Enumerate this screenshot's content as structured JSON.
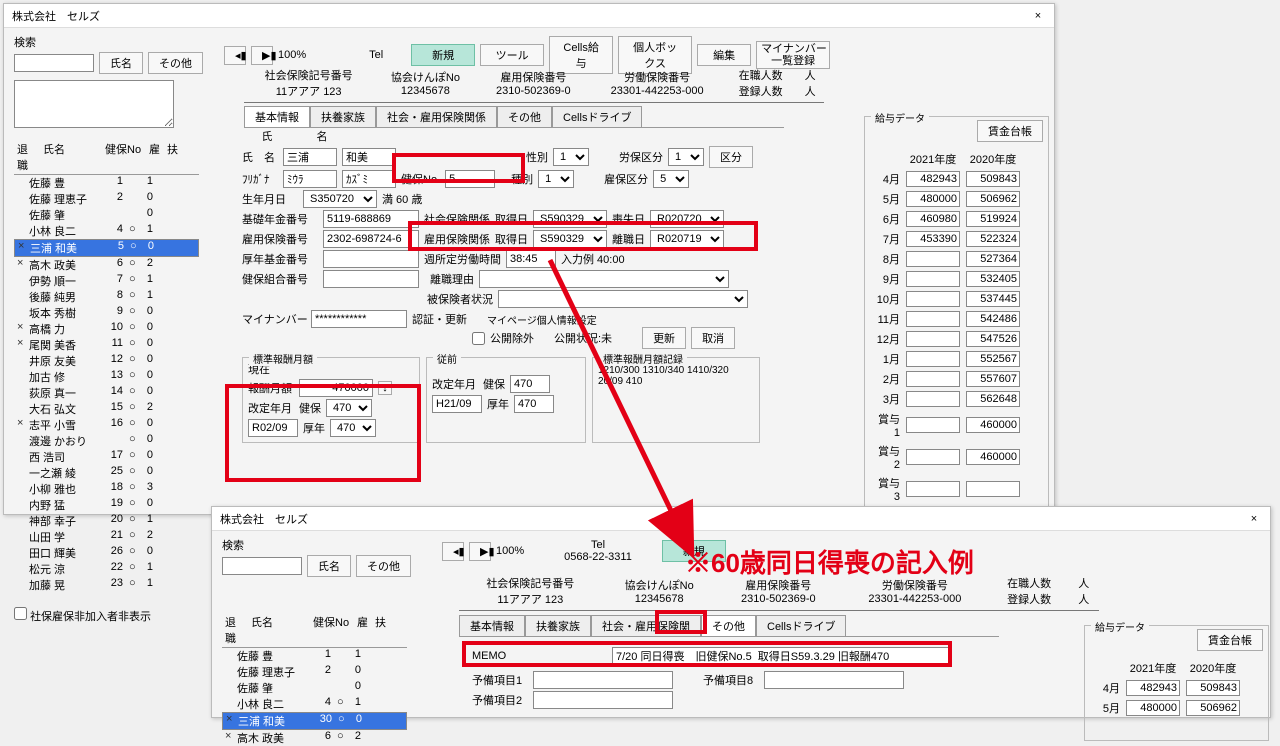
{
  "app_title": "株式会社　セルズ",
  "search": {
    "label": "検索",
    "btn_name": "氏名",
    "btn_other": "その他"
  },
  "chk_hiexclude": "社保雇保非加入者非表示",
  "nav": {
    "zoom": "100%",
    "tel": "Tel",
    "new": "新規",
    "tool": "ツール",
    "cellspay": "Cells給与",
    "personal": "個人ボックス",
    "edit": "編集",
    "mynumber": "マイナンバー\n一覧登録"
  },
  "nav2": {
    "tel": "Tel",
    "tel_val": "0568-22-3311"
  },
  "hdr": {
    "c1": {
      "label": "社会保険記号番号",
      "val": "11アアア 123"
    },
    "c2": {
      "label": "協会けんぽNo",
      "val": "12345678"
    },
    "c3": {
      "label": "雇用保険番号",
      "val": "2310-502369-0"
    },
    "c4": {
      "label": "労働保険番号",
      "val": "23301-442253-000"
    },
    "c5": {
      "label1": "在職人数",
      "label2": "登録人数",
      "unit": "人"
    }
  },
  "tabs": {
    "basic": "基本情報",
    "dependents": "扶養家族",
    "social": "社会・雇用保険関係",
    "other": "その他",
    "drive": "Cellsドライブ",
    "social2": "社会・雇用保険関"
  },
  "list": {
    "hdr": {
      "ret": "退職",
      "name": "氏名",
      "kenpo": "健保No",
      "emp": "雇",
      "dep": "扶"
    },
    "rows": [
      {
        "x": "",
        "n": "佐藤 豊",
        "k": "1",
        "e": "",
        "d": "1"
      },
      {
        "x": "",
        "n": "佐藤 理恵子",
        "k": "2",
        "e": "",
        "d": "0"
      },
      {
        "x": "",
        "n": "佐藤 肇",
        "k": "",
        "e": "",
        "d": "0"
      },
      {
        "x": "",
        "n": "小林 良二",
        "k": "4",
        "e": "○",
        "d": "1"
      },
      {
        "x": "×",
        "n": "三浦 和美",
        "k": "5",
        "e": "○",
        "d": "0",
        "sel": true
      },
      {
        "x": "×",
        "n": "高木 政美",
        "k": "6",
        "e": "○",
        "d": "2"
      },
      {
        "x": "",
        "n": "伊勢 順一",
        "k": "7",
        "e": "○",
        "d": "1"
      },
      {
        "x": "",
        "n": "後藤 純男",
        "k": "8",
        "e": "○",
        "d": "1"
      },
      {
        "x": "",
        "n": "坂本 秀樹",
        "k": "9",
        "e": "○",
        "d": "0"
      },
      {
        "x": "×",
        "n": "高橋 力",
        "k": "10",
        "e": "○",
        "d": "0"
      },
      {
        "x": "×",
        "n": "尾関 美香",
        "k": "11",
        "e": "○",
        "d": "0"
      },
      {
        "x": "",
        "n": "井原 友美",
        "k": "12",
        "e": "○",
        "d": "0"
      },
      {
        "x": "",
        "n": "加古 修",
        "k": "13",
        "e": "○",
        "d": "0"
      },
      {
        "x": "",
        "n": "荻原 真一",
        "k": "14",
        "e": "○",
        "d": "0"
      },
      {
        "x": "",
        "n": "大石 弘文",
        "k": "15",
        "e": "○",
        "d": "2"
      },
      {
        "x": "×",
        "n": "志平 小雪",
        "k": "16",
        "e": "○",
        "d": "0"
      },
      {
        "x": "",
        "n": "渡邊 かおり",
        "k": "",
        "e": "○",
        "d": "0"
      },
      {
        "x": "",
        "n": "西 浩司",
        "k": "17",
        "e": "○",
        "d": "0"
      },
      {
        "x": "",
        "n": "一之瀬 綾",
        "k": "25",
        "e": "○",
        "d": "0"
      },
      {
        "x": "",
        "n": "小柳 雅也",
        "k": "18",
        "e": "○",
        "d": "3"
      },
      {
        "x": "",
        "n": "内野 猛",
        "k": "19",
        "e": "○",
        "d": "0"
      },
      {
        "x": "",
        "n": "神部 幸子",
        "k": "20",
        "e": "○",
        "d": "1"
      },
      {
        "x": "",
        "n": "山田 学",
        "k": "21",
        "e": "○",
        "d": "2"
      },
      {
        "x": "",
        "n": "田口 輝美",
        "k": "26",
        "e": "○",
        "d": "0"
      },
      {
        "x": "",
        "n": "松元 涼",
        "k": "22",
        "e": "○",
        "d": "1"
      },
      {
        "x": "",
        "n": "加藤 晃",
        "k": "23",
        "e": "○",
        "d": "1"
      }
    ],
    "rows2": [
      {
        "x": "",
        "n": "佐藤 豊",
        "k": "1",
        "e": "",
        "d": "1"
      },
      {
        "x": "",
        "n": "佐藤 理恵子",
        "k": "2",
        "e": "",
        "d": "0"
      },
      {
        "x": "",
        "n": "佐藤 肇",
        "k": "",
        "e": "",
        "d": "0"
      },
      {
        "x": "",
        "n": "小林 良二",
        "k": "4",
        "e": "○",
        "d": "1"
      },
      {
        "x": "×",
        "n": "三浦 和美",
        "k": "30",
        "e": "○",
        "d": "0",
        "sel": true
      },
      {
        "x": "×",
        "n": "高木 政美",
        "k": "6",
        "e": "○",
        "d": "2"
      }
    ]
  },
  "form": {
    "name": {
      "lbl_shi": "氏",
      "lbl_mei": "名",
      "sei": "三浦",
      "mei": "和美",
      "kana_lbl": "ﾌﾘｶﾞﾅ",
      "kana1": "ﾐｳﾗ",
      "kana2": "ｶｽﾞﾐ"
    },
    "kenpo": {
      "lbl": "健保No.",
      "val": "5"
    },
    "seibetsu": {
      "lbl": "性別",
      "val": "1"
    },
    "syubetsu": {
      "lbl": "種別",
      "val": "1"
    },
    "roho": {
      "lbl": "労保区分",
      "val": "1",
      "btn": "区分"
    },
    "koho": {
      "lbl": "雇保区分",
      "val": "5"
    },
    "birth": {
      "lbl": "生年月日",
      "val": "S350720",
      "age": "満 60 歳"
    },
    "kiso": {
      "lbl": "基礎年金番号",
      "val": "5119-688869"
    },
    "koyo": {
      "lbl": "雇用保険番号",
      "val": "2302-698724-6"
    },
    "kosen": {
      "lbl": "厚年基金番号",
      "val": ""
    },
    "kenkumi": {
      "lbl": "健保組合番号",
      "val": ""
    },
    "mynum": {
      "lbl": "マイナンバー",
      "val": "************"
    },
    "shaho": {
      "lbl": "社会保険関係",
      "get": "取得日",
      "getv": "S590329",
      "lose": "喪失日",
      "losev": "R020720"
    },
    "koho2": {
      "lbl": "雇用保険関係",
      "get": "取得日",
      "getv": "S590329",
      "leave": "離職日",
      "leavev": "R020719"
    },
    "hours": {
      "lbl": "週所定労働時間",
      "val": "38:45",
      "ex": "入力例 40:00"
    },
    "rishoku": {
      "lbl": "離職理由"
    },
    "hihoken": {
      "lbl": "被保険者状況"
    },
    "nintei": {
      "lbl": "認証・更新",
      "mypage": "マイページ個人情報設定",
      "exclude": "公開除外",
      "status": "公開状況:未",
      "btn_upd": "更新",
      "btn_cancel": "取消"
    }
  },
  "sal": {
    "title": "標準報酬月額",
    "now": {
      "lbl": "現在",
      "gkk": "報酬月額",
      "gkk_v": "470000",
      "kaitei": "改定年月",
      "kaitei_v": "R02/09",
      "kenpo": "健保",
      "kenpo_v": "470",
      "kosen": "厚年",
      "kosen_v": "470"
    },
    "prev": {
      "lbl": "従前",
      "kaitei": "改定年月",
      "kaitei_v": "H21/09",
      "kenpo": "健保",
      "kenpo_v": "470",
      "kosen": "厚年",
      "kosen_v": "470"
    },
    "hist": {
      "lbl": "標準報酬月額記録",
      "txt": "1210/300 1310/340 1410/320\n20/09 410"
    }
  },
  "pay": {
    "title": "給与データ",
    "btn": "賃金台帳",
    "y1": "2021年度",
    "y2": "2020年度",
    "rows": [
      {
        "m": "4月",
        "a": "482943",
        "b": "509843"
      },
      {
        "m": "5月",
        "a": "480000",
        "b": "506962"
      },
      {
        "m": "6月",
        "a": "460980",
        "b": "519924"
      },
      {
        "m": "7月",
        "a": "453390",
        "b": "522324"
      },
      {
        "m": "8月",
        "a": "",
        "b": "527364"
      },
      {
        "m": "9月",
        "a": "",
        "b": "532405"
      },
      {
        "m": "10月",
        "a": "",
        "b": "537445"
      },
      {
        "m": "11月",
        "a": "",
        "b": "542486"
      },
      {
        "m": "12月",
        "a": "",
        "b": "547526"
      },
      {
        "m": "1月",
        "a": "",
        "b": "552567"
      },
      {
        "m": "2月",
        "a": "",
        "b": "557607"
      },
      {
        "m": "3月",
        "a": "",
        "b": "562648"
      },
      {
        "m": "賞与1",
        "a": "",
        "b": "460000"
      },
      {
        "m": "賞与2",
        "a": "",
        "b": "460000"
      },
      {
        "m": "賞与3",
        "a": "",
        "b": ""
      }
    ],
    "rows2": [
      {
        "m": "4月",
        "a": "482943",
        "b": "509843"
      },
      {
        "m": "5月",
        "a": "480000",
        "b": "506962"
      }
    ]
  },
  "other": {
    "memo_lbl": "MEMO",
    "memo_val": "7/20 同日得喪　旧健保No.5  取得日S59.3.29 旧報酬470",
    "p1": "予備項目1",
    "p2": "予備項目2",
    "p8": "予備項目8"
  },
  "note": "※60歳同日得喪の記入例"
}
